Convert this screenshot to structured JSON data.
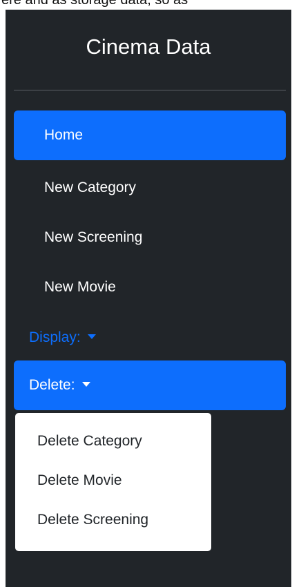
{
  "header_fragment": "ere and as storage data, so as",
  "sidebar": {
    "brand": "Cinema Data",
    "nav": [
      {
        "label": "Home",
        "active": true
      },
      {
        "label": "New Category",
        "active": false
      },
      {
        "label": "New Screening",
        "active": false
      },
      {
        "label": "New Movie",
        "active": false
      }
    ],
    "display_toggle": {
      "label": "Display:",
      "icon": "caret-down-icon"
    },
    "delete_toggle": {
      "label": "Delete:",
      "icon": "caret-down-icon",
      "expanded": true
    },
    "delete_menu": [
      {
        "label": "Delete Category"
      },
      {
        "label": "Delete Movie"
      },
      {
        "label": "Delete Screening"
      }
    ]
  },
  "colors": {
    "sidebar_bg": "#212529",
    "accent": "#0d6efd",
    "text_light": "#ffffff",
    "text_dark": "#212529"
  }
}
